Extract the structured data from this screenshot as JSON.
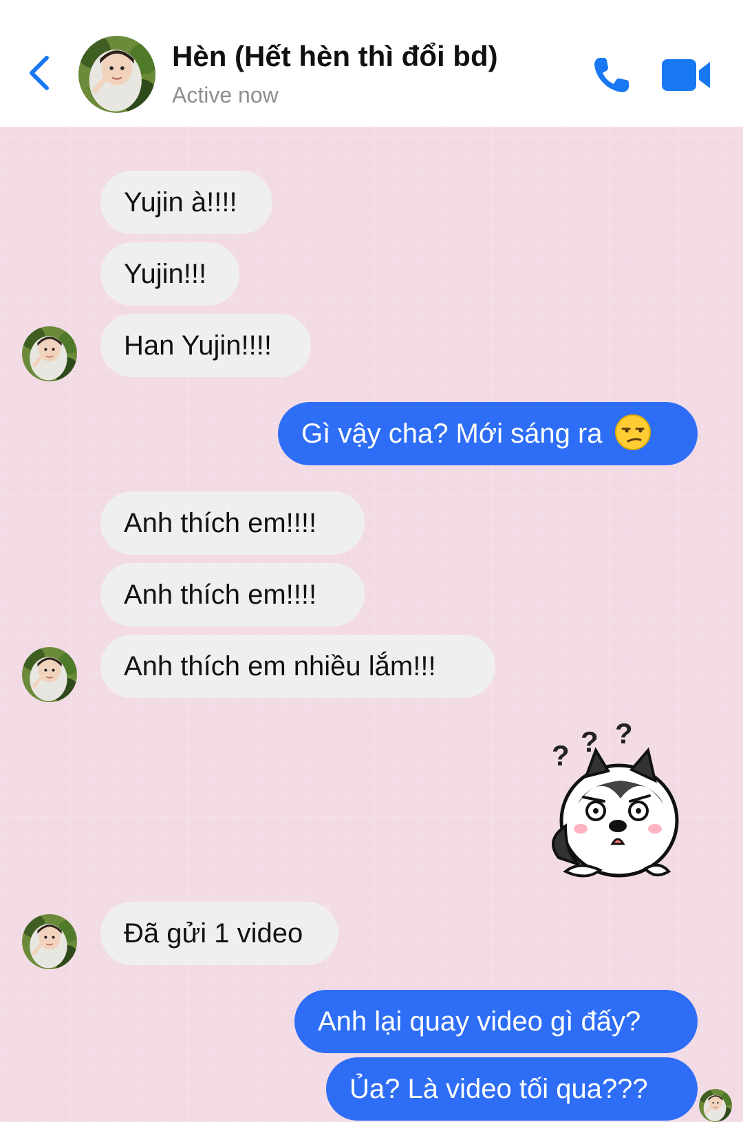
{
  "header": {
    "contact_name": "Hèn (Hết hèn thì đổi bd)",
    "status": "Active now",
    "icons": [
      "chevron-left-icon",
      "avatar",
      "phone-icon",
      "video-camera-icon"
    ],
    "accent_color": "#1877f2"
  },
  "chat": {
    "background_color": "#f3dbe6",
    "incoming_bubble_color": "#efefef",
    "outgoing_bubble_color": "#2e6ef6",
    "messages": [
      {
        "sender": "contact",
        "text": "Yujin à!!!!"
      },
      {
        "sender": "contact",
        "text": "Yujin!!!"
      },
      {
        "sender": "contact",
        "text": "Han Yujin!!!!"
      },
      {
        "sender": "me",
        "text": "Gì vậy cha? Mới sáng ra",
        "emoji": "unamused-face"
      },
      {
        "sender": "contact",
        "text": "Anh thích em!!!!"
      },
      {
        "sender": "contact",
        "text": "Anh thích em!!!!"
      },
      {
        "sender": "contact",
        "text": "Anh thích em nhiều lắm!!!"
      },
      {
        "sender": "me",
        "sticker": "confused-husky-sticker"
      },
      {
        "sender": "contact",
        "text": "Đã gửi 1 video"
      },
      {
        "sender": "me",
        "text": "Anh lại quay video gì đấy?"
      },
      {
        "sender": "me",
        "text": "Ủa? Là video tối qua???"
      }
    ],
    "sticker_text": "? ? ?"
  }
}
